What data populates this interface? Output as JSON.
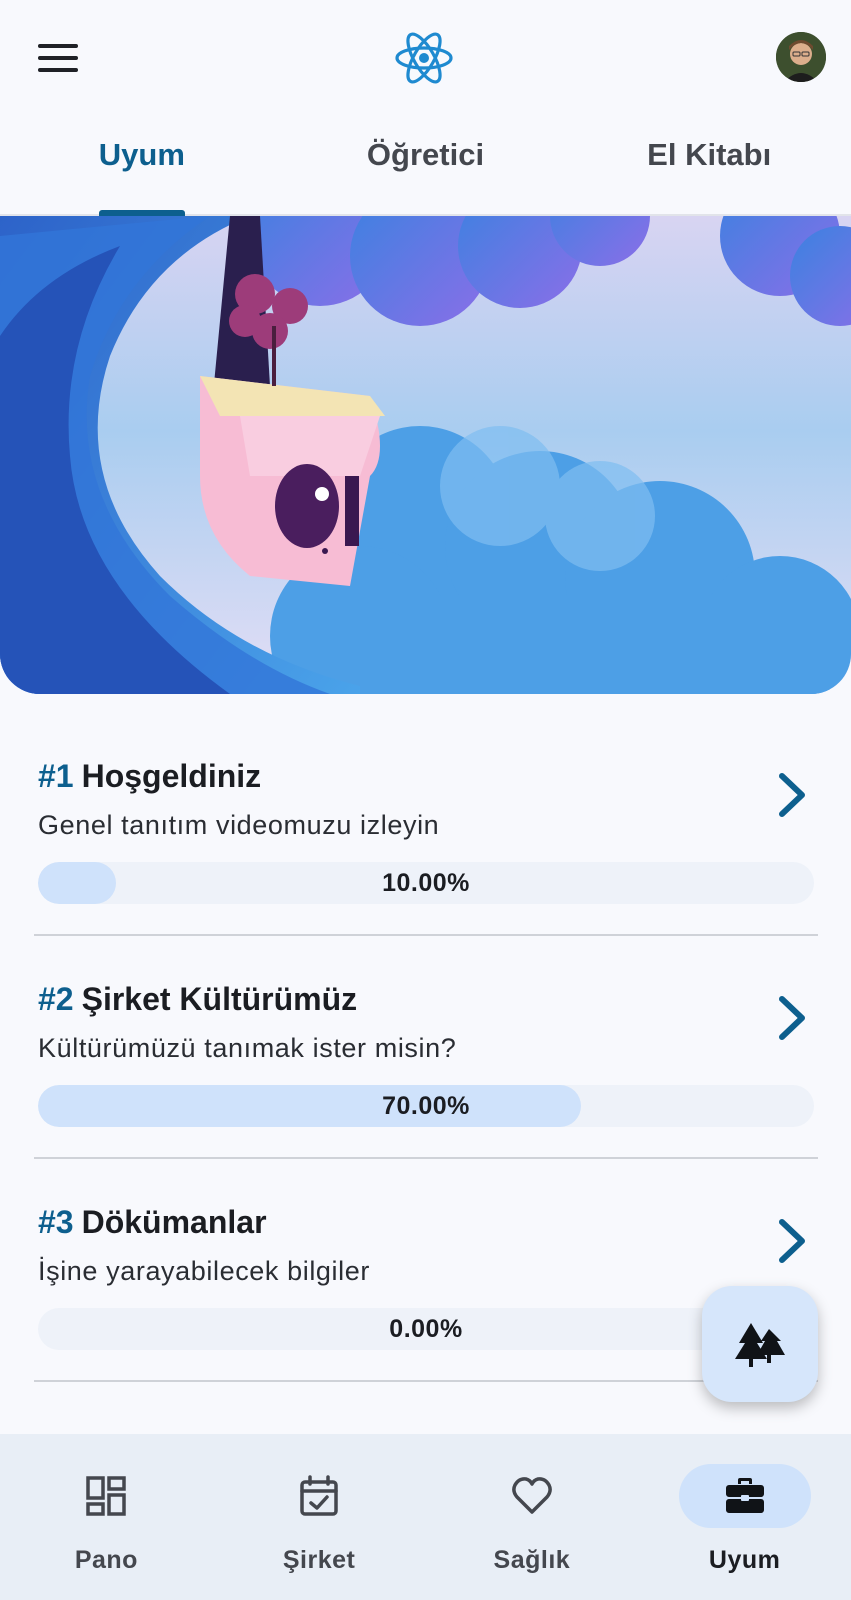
{
  "header": {
    "menu_icon": "menu-icon",
    "logo_icon": "atom-logo-icon",
    "avatar_icon": "user-avatar"
  },
  "tabs": [
    {
      "label": "Uyum",
      "active": true
    },
    {
      "label": "Öğretici",
      "active": false
    },
    {
      "label": "El Kitabı",
      "active": false
    }
  ],
  "items": [
    {
      "number": "#1",
      "title": "Hoşgeldiniz",
      "subtitle": "Genel tanıtım videomuzu izleyin",
      "progress": 0.1,
      "progress_label": "10.00%"
    },
    {
      "number": "#2",
      "title": "Şirket Kültürümüz",
      "subtitle": "Kültürümüzü tanımak ister misin?",
      "progress": 0.7,
      "progress_label": "70.00%"
    },
    {
      "number": "#3",
      "title": "Dökümanlar",
      "subtitle": "İşine yarayabilecek bilgiler",
      "progress": 0.0,
      "progress_label": "0.00%"
    }
  ],
  "fab": {
    "icon": "trees-icon"
  },
  "bottom_nav": [
    {
      "label": "Pano",
      "icon": "dashboard-icon",
      "active": false
    },
    {
      "label": "Şirket",
      "icon": "calendar-check-icon",
      "active": false
    },
    {
      "label": "Sağlık",
      "icon": "heart-icon",
      "active": false
    },
    {
      "label": "Uyum",
      "icon": "briefcase-icon",
      "active": true
    }
  ],
  "colors": {
    "accent": "#0d5f8e",
    "progress_fill": "#cfe2fb",
    "progress_track": "#eef2f9",
    "nav_background": "#e8eef6"
  }
}
